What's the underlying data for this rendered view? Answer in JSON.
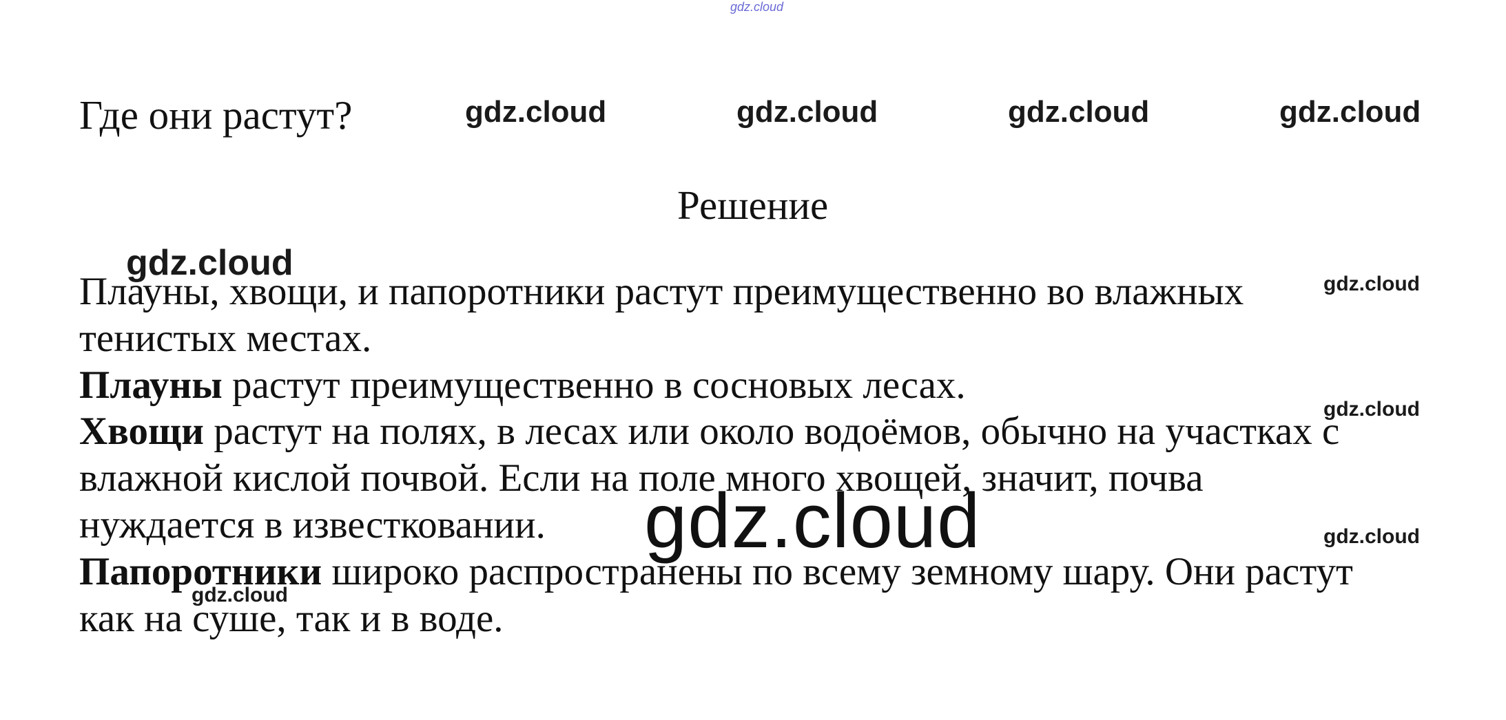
{
  "question": "Где они растут?",
  "solution_heading": "Решение",
  "answer": {
    "line1": "Плауны, хвощи, и папоротники растут преимущественно во влажных",
    "line2": "тенистых местах.",
    "p2_bold": "Плауны",
    "p2_rest": " растут преимущественно в сосновых лесах.",
    "p3_bold": "Хвощи",
    "p3_rest": " растут на полях, в лесах или около водоёмов, обычно на участках с",
    "p3_line2": "влажной кислой почвой. Если на поле много хвощей, значит, почва",
    "p3_line3": "нуждается в известковании.",
    "p4_bold": "Папоротники",
    "p4_rest": " широко распространены по всему земному шару. Они растут",
    "p4_line2": "как на суше, так и в воде."
  },
  "watermarks": {
    "top": "gdz.cloud",
    "row1": [
      "gdz.cloud",
      "gdz.cloud",
      "gdz.cloud",
      "gdz.cloud"
    ],
    "left": "gdz.cloud",
    "right": [
      "gdz.cloud",
      "gdz.cloud",
      "gdz.cloud"
    ],
    "big": "gdz.cloud",
    "small_bottom": "gdz.cloud"
  }
}
